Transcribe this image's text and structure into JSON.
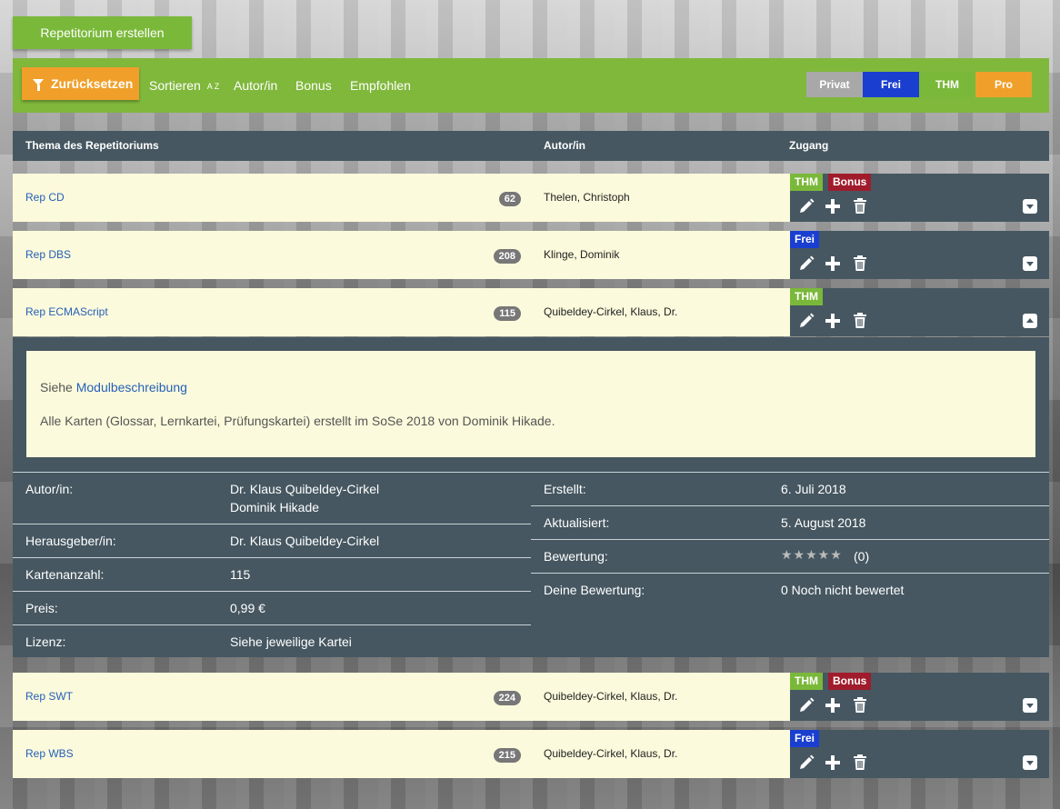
{
  "create_button": "Repetitorium erstellen",
  "toolbar": {
    "reset_label": "Zurücksetzen",
    "sort_label": "Sortieren",
    "sort_icon": "A Z",
    "author_label": "Autor/in",
    "bonus_label": "Bonus",
    "recommended_label": "Empfohlen",
    "filters": [
      {
        "label": "Privat",
        "color": "#a8a8a8"
      },
      {
        "label": "Frei",
        "color": "#1a3fd0"
      },
      {
        "label": "THM",
        "color": "#7ab83a"
      },
      {
        "label": "Pro",
        "color": "#f0a02a"
      }
    ]
  },
  "table_header": {
    "topic": "Thema des Repetitoriums",
    "author": "Autor/in",
    "access": "Zugang"
  },
  "rows": [
    {
      "title": "Rep CD",
      "count": "62",
      "author": "Thelen, Christoph",
      "badges": [
        "THM",
        "Bonus"
      ]
    },
    {
      "title": "Rep DBS",
      "count": "208",
      "author": "Klinge, Dominik",
      "badges": [
        "Frei"
      ]
    },
    {
      "title": "Rep ECMAScript",
      "count": "115",
      "author": "Quibeldey-Cirkel, Klaus, Dr.",
      "badges": [
        "THM"
      ]
    },
    {
      "title": "Rep SWT",
      "count": "224",
      "author": "Quibeldey-Cirkel, Klaus, Dr.",
      "badges": [
        "THM",
        "Bonus"
      ]
    },
    {
      "title": "Rep WBS",
      "count": "215",
      "author": "Quibeldey-Cirkel, Klaus, Dr.",
      "badges": [
        "Frei"
      ]
    }
  ],
  "details": {
    "desc_prefix": "Siehe",
    "desc_link": "Modulbeschreibung",
    "desc_text": "Alle Karten (Glossar, Lernkartei, Prüfungskartei) erstellt im SoSe 2018 von Dominik Hikade.",
    "left": [
      {
        "label": "Autor/in:",
        "value": "Dr. Klaus Quibeldey-Cirkel",
        "value2": "Dominik Hikade"
      },
      {
        "label": "Herausgeber/in:",
        "value": "Dr. Klaus Quibeldey-Cirkel"
      },
      {
        "label": "Kartenanzahl:",
        "value": "115"
      },
      {
        "label": "Preis:",
        "value": "0,99 €"
      },
      {
        "label": "Lizenz:",
        "value": "Siehe jeweilige Kartei"
      }
    ],
    "right": [
      {
        "label": "Erstellt:",
        "value": "6. Juli 2018"
      },
      {
        "label": "Aktualisiert:",
        "value": "5. August 2018"
      },
      {
        "label": "Bewertung:",
        "stars": "★★★★★",
        "value": "(0)"
      },
      {
        "label": "Deine Bewertung:",
        "value": "0 Noch nicht bewertet"
      }
    ]
  }
}
